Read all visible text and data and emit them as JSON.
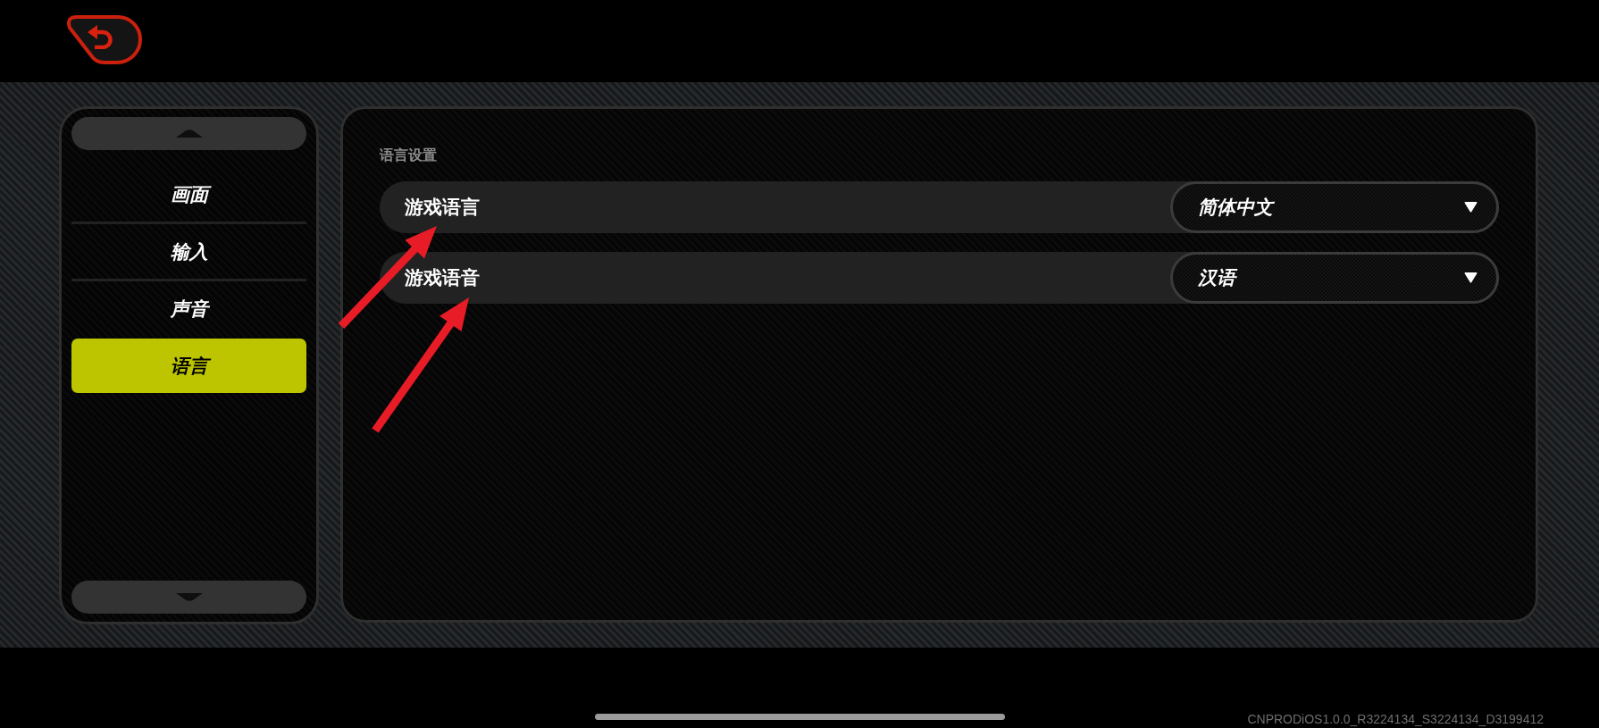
{
  "sidebar": {
    "items": [
      {
        "label": "画面",
        "selected": false
      },
      {
        "label": "输入",
        "selected": false
      },
      {
        "label": "声音",
        "selected": false
      },
      {
        "label": "语言",
        "selected": true
      }
    ]
  },
  "settings": {
    "title": "语言设置",
    "rows": [
      {
        "label": "游戏语言",
        "value": "简体中文"
      },
      {
        "label": "游戏语音",
        "value": "汉语"
      }
    ]
  },
  "annotations": [
    {
      "kind": "arrow"
    },
    {
      "kind": "arrow"
    }
  ],
  "version": "CNPRODiOS1.0.0_R3224134_S3224134_D3199412"
}
